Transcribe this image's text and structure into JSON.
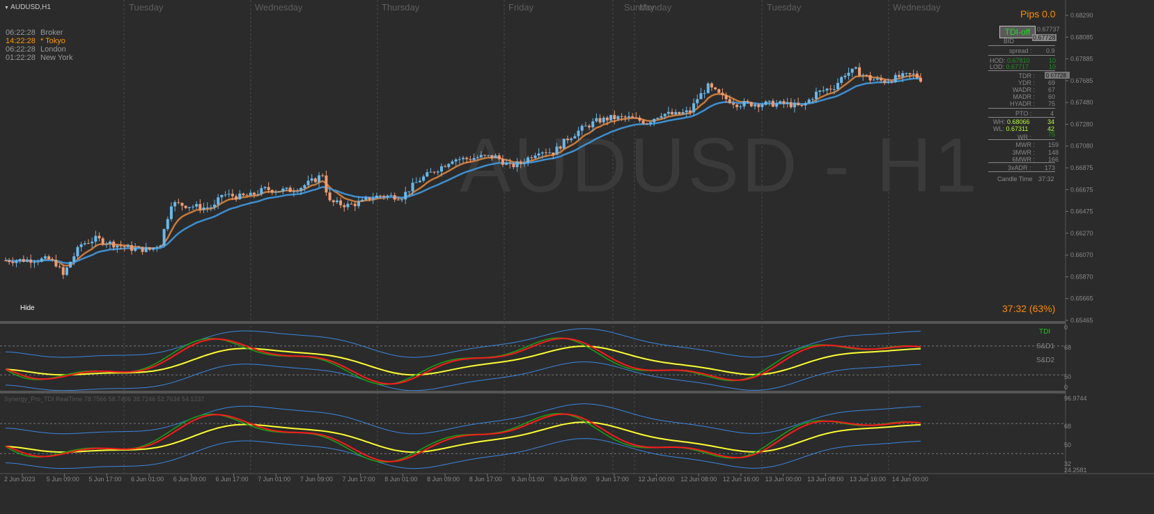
{
  "window": {
    "title": "AUDUSD,H1",
    "watermark": "AUDUSD - H1",
    "hide_label": "Hide"
  },
  "colors": {
    "bg": "#2b2b2b",
    "bull": "#6ab8ea",
    "bear": "#f09c74",
    "ema_fast": "#c87a3c",
    "ema_slow": "#3e8fd0",
    "tdi_green": "#14a014",
    "tdi_red": "#ff1a1a",
    "tdi_yellow": "#ffff33",
    "tdi_band": "#3a86e0",
    "accent": "#ff8c00"
  },
  "day_labels": [
    "Tuesday",
    "Wednesday",
    "Thursday",
    "Friday",
    "Sunday",
    "Monday",
    "Tuesday",
    "Wednesday"
  ],
  "sessions": [
    {
      "time": "06:22:28",
      "name": "Broker",
      "active": false
    },
    {
      "time": "14:22:28",
      "name": "* Tokyo",
      "active": true
    },
    {
      "time": "06:22:28",
      "name": "London",
      "active": false
    },
    {
      "time": "01:22:28",
      "name": "New York",
      "active": false
    }
  ],
  "price_axis": [
    "0.68290",
    "0.68085",
    "0.67885",
    "0.67685",
    "0.67480",
    "0.67280",
    "0.67080",
    "0.66875",
    "0.66675",
    "0.66475",
    "0.66270",
    "0.66070",
    "0.65870",
    "0.65665",
    "0.65465"
  ],
  "current_price": "0.67728",
  "dashboard": {
    "pips": "Pips 0.0",
    "tdi_button": "TDI-off",
    "ask_label": "0.67737",
    "bid_label": "BID",
    "bid_value": "0.67728",
    "spread_label": "spread :",
    "spread_value": "0.9",
    "hod_label": "HOD:",
    "hod_price": "0.67810",
    "hod_pips": "10",
    "lod_label": "LOD:",
    "lod_price": "0.67717",
    "lod_pips": "10",
    "rows1": [
      [
        "TDR :",
        "19"
      ],
      [
        "YDR :",
        "69"
      ],
      [
        "WADR :",
        "67"
      ],
      [
        "MADR :",
        "60"
      ],
      [
        "HYADR :",
        "75"
      ]
    ],
    "pto_label": "PTO :",
    "pto_value": "4",
    "wh_label": "WH:",
    "wh_price": "0.68066",
    "wh_pips": "34",
    "wl_label": "WL:",
    "wl_price": "0.67311",
    "wl_pips": "42",
    "wr_label": "WR :",
    "wr_value": "75",
    "rows2": [
      [
        "MWR :",
        "159"
      ],
      [
        "3MWR :",
        "148"
      ],
      [
        "6MWR :",
        "166"
      ]
    ],
    "adr3_label": "3xADR :",
    "adr3_value": "173",
    "candle_time_label": "Candle Time",
    "candle_time_value": "37:32",
    "countdown": "37:32 (63%)"
  },
  "tdi1": {
    "label": "TDI",
    "sd1": "S&D1",
    "sd2": "S&D2",
    "axis": [
      "0",
      "68",
      "50",
      "0"
    ]
  },
  "tdi2": {
    "title": "Synergy_Pro_TDI RealTime 78.7566 58.7406 38.7246 52.7634 54.1237",
    "axis": [
      "96.9744",
      "68",
      "50",
      "32",
      "24.2581"
    ]
  },
  "time_axis": [
    "2 Jun 2023",
    "5 Jun 09:00",
    "5 Jun 17:00",
    "6 Jun 01:00",
    "6 Jun 09:00",
    "6 Jun 17:00",
    "7 Jun 01:00",
    "7 Jun 09:00",
    "7 Jun 17:00",
    "8 Jun 01:00",
    "8 Jun 09:00",
    "8 Jun 17:00",
    "9 Jun 01:00",
    "9 Jun 09:00",
    "9 Jun 17:00",
    "12 Jun 00:00",
    "12 Jun 08:00",
    "12 Jun 16:00",
    "13 Jun 00:00",
    "13 Jun 08:00",
    "13 Jun 16:00",
    "14 Jun 00:00"
  ],
  "price_series": {
    "anchors": [
      [
        0,
        0.6602
      ],
      [
        12,
        0.6603
      ],
      [
        14,
        0.6599
      ],
      [
        16,
        0.6588
      ],
      [
        18,
        0.6601
      ],
      [
        21,
        0.6617
      ],
      [
        25,
        0.6622
      ],
      [
        30,
        0.6617
      ],
      [
        35,
        0.6613
      ],
      [
        40,
        0.6612
      ],
      [
        43,
        0.6618
      ],
      [
        46,
        0.6655
      ],
      [
        50,
        0.6653
      ],
      [
        55,
        0.6651
      ],
      [
        58,
        0.6652
      ],
      [
        60,
        0.6663
      ],
      [
        65,
        0.6661
      ],
      [
        68,
        0.6662
      ],
      [
        72,
        0.6668
      ],
      [
        75,
        0.6667
      ],
      [
        79,
        0.6667
      ],
      [
        82,
        0.667
      ],
      [
        86,
        0.6677
      ],
      [
        88,
        0.6682
      ],
      [
        89,
        0.6667
      ],
      [
        90,
        0.6656
      ],
      [
        95,
        0.6653
      ],
      [
        99,
        0.6656
      ],
      [
        101,
        0.666
      ],
      [
        104,
        0.6662
      ],
      [
        110,
        0.6661
      ],
      [
        112,
        0.6668
      ],
      [
        115,
        0.6677
      ],
      [
        118,
        0.6683
      ],
      [
        122,
        0.6691
      ],
      [
        124,
        0.6696
      ],
      [
        128,
        0.6696
      ],
      [
        132,
        0.6698
      ],
      [
        136,
        0.6698
      ],
      [
        140,
        0.6689
      ],
      [
        143,
        0.6692
      ],
      [
        148,
        0.6704
      ],
      [
        152,
        0.6702
      ],
      [
        156,
        0.6715
      ],
      [
        160,
        0.6724
      ],
      [
        164,
        0.6731
      ],
      [
        168,
        0.6734
      ],
      [
        173,
        0.6734
      ],
      [
        178,
        0.673
      ],
      [
        182,
        0.6738
      ],
      [
        186,
        0.6737
      ],
      [
        190,
        0.674
      ],
      [
        192,
        0.6752
      ],
      [
        195,
        0.6763
      ],
      [
        199,
        0.6753
      ],
      [
        203,
        0.6747
      ],
      [
        207,
        0.6747
      ],
      [
        212,
        0.6747
      ],
      [
        217,
        0.6747
      ],
      [
        221,
        0.6744
      ],
      [
        225,
        0.6757
      ],
      [
        230,
        0.6763
      ],
      [
        233,
        0.6775
      ],
      [
        236,
        0.6778
      ],
      [
        240,
        0.677
      ],
      [
        244,
        0.6768
      ],
      [
        248,
        0.6772
      ],
      [
        252,
        0.6774
      ],
      [
        254,
        0.677
      ]
    ]
  }
}
